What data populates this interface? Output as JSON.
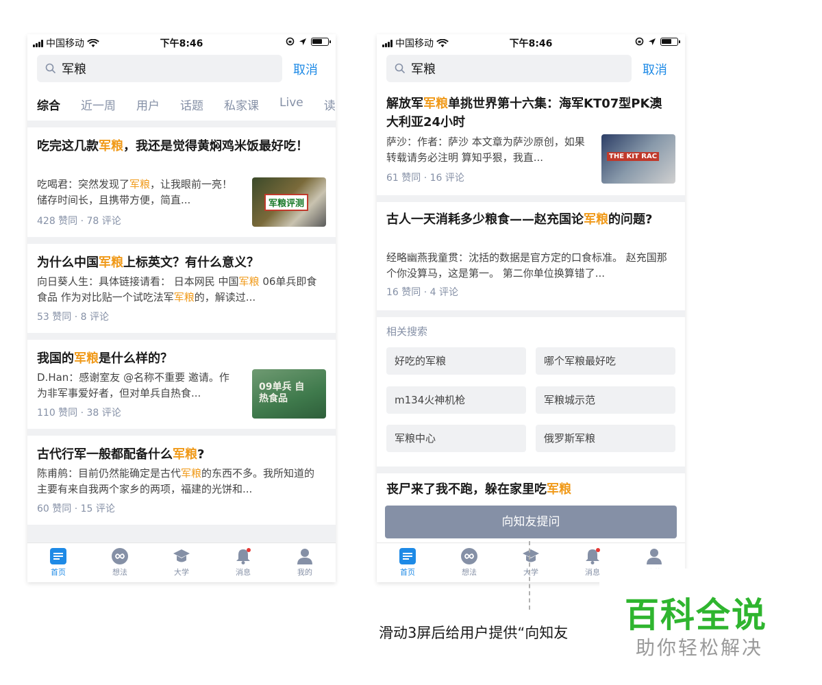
{
  "status_bar": {
    "carrier": "中国移动",
    "time": "下午8:46"
  },
  "search": {
    "query": "军粮",
    "cancel_label": "取消"
  },
  "tabs": [
    {
      "label": "综合",
      "active": true
    },
    {
      "label": "近一周"
    },
    {
      "label": "用户"
    },
    {
      "label": "话题"
    },
    {
      "label": "私家课"
    },
    {
      "label": "Live"
    },
    {
      "label": "读"
    }
  ],
  "left_feed": [
    {
      "title_pre": "吃完这几款",
      "title_hl": "军粮",
      "title_post": "，我还是觉得黄焖鸡米饭最好吃！",
      "excerpt_pre": "吃喝君：突然发现了",
      "excerpt_hl": "军粮",
      "excerpt_post": "，让我眼前一亮！储存时间长，且携带方便，简直...",
      "stats": "428 赞同 · 78 评论",
      "thumb_text": "军粮评测"
    },
    {
      "title_pre": "为什么中国",
      "title_hl": "军粮",
      "title_post": "上标英文？有什么意义？",
      "excerpt_a": "向日葵人生：具体链接请看： 日本网民 中国",
      "excerpt_hl": "军粮",
      "excerpt_b": " 06单兵即食食品 作为对比贴一个试吃法军",
      "excerpt_hl2": "军粮",
      "excerpt_c": "的，解读过...",
      "stats": "53 赞同 · 8 评论"
    },
    {
      "title_pre": "我国的",
      "title_hl": "军粮",
      "title_post": "是什么样的？",
      "excerpt": "D.Han：感谢室友 @名称不重要 邀请。作为非军事爱好者，但对单兵自热食...",
      "stats": "110 赞同 · 38 评论",
      "thumb_text": "09单兵 自热食品"
    },
    {
      "title_pre": "古代行军一般都配备什么",
      "title_hl": "军粮",
      "title_post": "?",
      "excerpt_pre": "陈甫鸼：目前仍然能确定是古代",
      "excerpt_hl": "军粮",
      "excerpt_post": "的东西不多。我所知道的主要有来自我两个家乡的两项，福建的光饼和...",
      "stats": "60 赞同 · 15 评论"
    }
  ],
  "right_feed": [
    {
      "title_pre": "解放军",
      "title_hl": "军粮",
      "title_post": "单挑世界第十六集：海军KT07型PK澳大利亚24小时",
      "excerpt": "萨沙：作者：萨沙 本文章为萨沙原创，如果转载请务必注明 算知乎狠，我直...",
      "stats": "61 赞同 · 16 评论",
      "thumb_text": "THE KIT RAC"
    },
    {
      "title_pre": "古人一天消耗多少粮食——赵充国论",
      "title_hl": "军粮",
      "title_post": "的问题?",
      "excerpt": "经略幽燕我童贯：沈括的数据是官方定的口食标准。 赵充国那个你没算马，这是第一。 第二你单位换算错了...",
      "stats": "16 赞同 · 4 评论"
    },
    {
      "title_pre": "丧尸来了我不跑，躲在家里吃",
      "title_hl": "军粮",
      "title_post": ""
    }
  ],
  "related": {
    "title": "相关搜索",
    "items": [
      "好吃的军粮",
      "哪个军粮最好吃",
      "m134火神机枪",
      "军粮城示范",
      "军粮中心",
      "俄罗斯军粮"
    ]
  },
  "ask_button_label": "向知友提问",
  "tabbar": [
    {
      "label": "首页",
      "icon": "home-icon",
      "active": true
    },
    {
      "label": "想法",
      "icon": "ideas-icon"
    },
    {
      "label": "大学",
      "icon": "graduation-cap-icon"
    },
    {
      "label": "消息",
      "icon": "bell-icon"
    },
    {
      "label": "我的",
      "icon": "person-icon"
    }
  ],
  "caption": "滑动3屏后给用户提供“向知友",
  "watermark": {
    "main": "百科全说",
    "sub": "助你轻松解决"
  },
  "colors": {
    "accent": "#1e8ae6",
    "highlight": "#f09a1a",
    "button": "#8590a6",
    "divider": "#f0f1f3",
    "watermark": "#2fb52f"
  }
}
